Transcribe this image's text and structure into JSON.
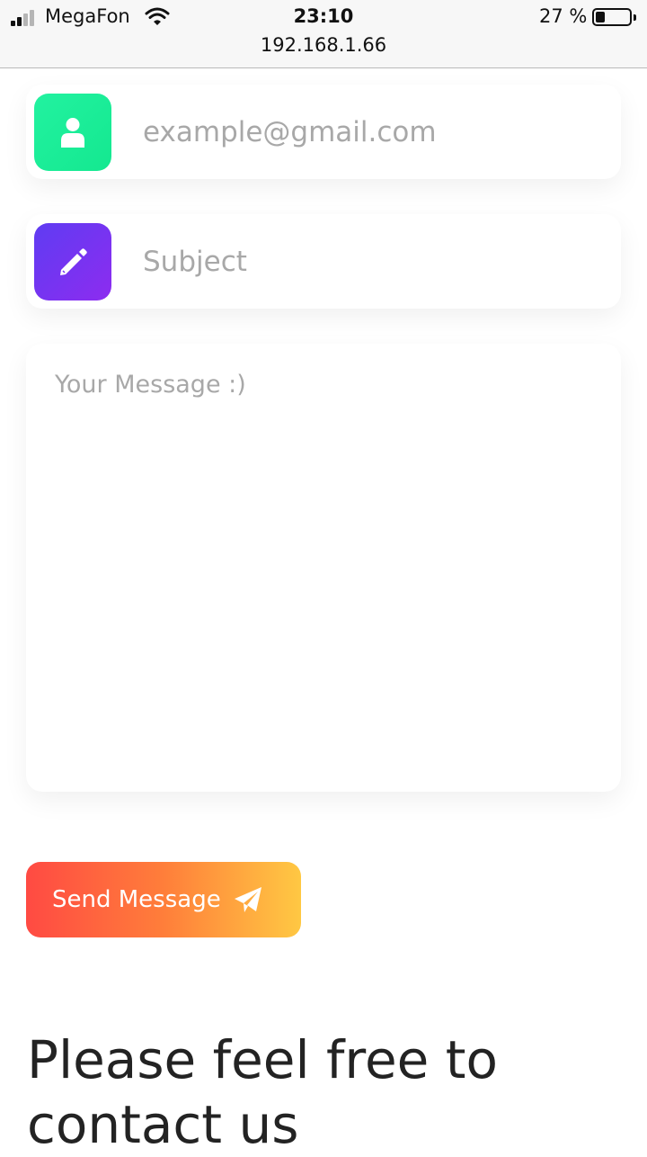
{
  "status_bar": {
    "carrier": "MegaFon",
    "time": "23:10",
    "battery_text": "27 %",
    "battery_level": 0.27,
    "signal_bars_filled": 2,
    "signal_bars_total": 4,
    "url": "192.168.1.66"
  },
  "form": {
    "email": {
      "placeholder": "example@gmail.com",
      "value": "",
      "icon": "user-icon",
      "icon_color": "#1ef0a0"
    },
    "subject": {
      "placeholder": "Subject",
      "value": "",
      "icon": "pencil-icon",
      "icon_color": "#7431f2"
    },
    "message": {
      "placeholder": "Your Message :)",
      "value": ""
    },
    "send_label": "Send Message",
    "send_icon": "paper-plane-icon"
  },
  "heading": "Please feel free to contact us",
  "colors": {
    "send_gradient_start": "#ff4a43",
    "send_gradient_end": "#ffc843",
    "heading_text": "#232323"
  }
}
